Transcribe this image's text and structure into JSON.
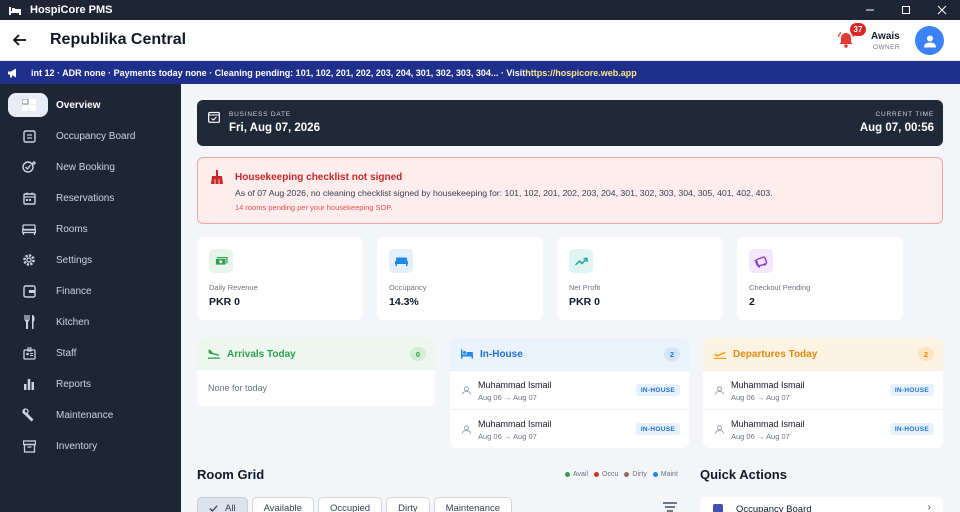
{
  "window": {
    "title": "HospiCore PMS"
  },
  "header": {
    "hotel_name": "Republika Central",
    "notification_count": "37",
    "user_name": "Awais",
    "user_role": "OWNER"
  },
  "ticker": {
    "text": "int 12 · ADR none · Payments today none · Cleaning pending: 101, 102, 201, 202, 203, 204, 301, 302, 303, 304... · Visit ",
    "url": "https://hospicore.web.app"
  },
  "sidebar": {
    "items": [
      {
        "label": "Overview",
        "icon": "dashboard-icon"
      },
      {
        "label": "Occupancy Board",
        "icon": "board-icon"
      },
      {
        "label": "New Booking",
        "icon": "add-booking-icon"
      },
      {
        "label": "Reservations",
        "icon": "calendar-icon"
      },
      {
        "label": "Rooms",
        "icon": "bed-icon"
      },
      {
        "label": "Settings",
        "icon": "gear-icon"
      },
      {
        "label": "Finance",
        "icon": "wallet-icon"
      },
      {
        "label": "Kitchen",
        "icon": "utensils-icon"
      },
      {
        "label": "Staff",
        "icon": "badge-icon"
      },
      {
        "label": "Reports",
        "icon": "bar-chart-icon"
      },
      {
        "label": "Maintenance",
        "icon": "wrench-icon"
      },
      {
        "label": "Inventory",
        "icon": "archive-icon"
      }
    ]
  },
  "business": {
    "date_label": "BUSINESS DATE",
    "date_value": "Fri, Aug 07, 2026",
    "time_label": "CURRENT TIME",
    "time_value": "Aug 07, 00:56"
  },
  "alert": {
    "title": "Housekeeping checklist not signed",
    "message": "As of 07 Aug 2026, no cleaning checklist signed by housekeeping for: 101, 102, 201, 202, 203, 204, 301, 302, 303, 304, 305, 401, 402, 403.",
    "note": "14 rooms pending per your housekeeping SOP."
  },
  "stats": [
    {
      "label": "Daily Revenue",
      "value": "PKR 0",
      "icon": "cash-icon",
      "color": "#2e9e4f"
    },
    {
      "label": "Occupancy",
      "value": "14.3%",
      "icon": "bed-icon",
      "color": "#1e88e5"
    },
    {
      "label": "Net Profit",
      "value": "PKR 0",
      "icon": "trend-up-icon",
      "color": "#1aa398"
    },
    {
      "label": "Checkout Pending",
      "value": "2",
      "icon": "luggage-icon",
      "color": "#8e3fbf"
    }
  ],
  "panels": {
    "arrivals": {
      "title": "Arrivals Today",
      "count": "0",
      "empty": "None for today"
    },
    "inhouse": {
      "title": "In-House",
      "count": "2",
      "guests": [
        {
          "name": "Muhammad Ismail",
          "dates": "Aug 06 → Aug 07",
          "badge": "IN-HOUSE"
        },
        {
          "name": "Muhammad Ismail",
          "dates": "Aug 06 → Aug 07",
          "badge": "IN-HOUSE"
        }
      ]
    },
    "departures": {
      "title": "Departures Today",
      "count": "2",
      "guests": [
        {
          "name": "Muhammad Ismail",
          "dates": "Aug 06 → Aug 07",
          "badge": "IN-HOUSE"
        },
        {
          "name": "Muhammad Ismail",
          "dates": "Aug 06 → Aug 07",
          "badge": "IN-HOUSE"
        }
      ]
    }
  },
  "room_grid": {
    "title": "Room Grid",
    "legend": [
      {
        "label": "Avail",
        "color": "#2e9e4f"
      },
      {
        "label": "Occu",
        "color": "#d93025"
      },
      {
        "label": "Dirty",
        "color": "#8d6e63"
      },
      {
        "label": "Maint",
        "color": "#1e88e5"
      }
    ],
    "filters": [
      "All",
      "Available",
      "Occupied",
      "Dirty",
      "Maintenance"
    ]
  },
  "quick_actions": {
    "title": "Quick Actions",
    "items": [
      {
        "label": "Occupancy Board"
      }
    ]
  }
}
